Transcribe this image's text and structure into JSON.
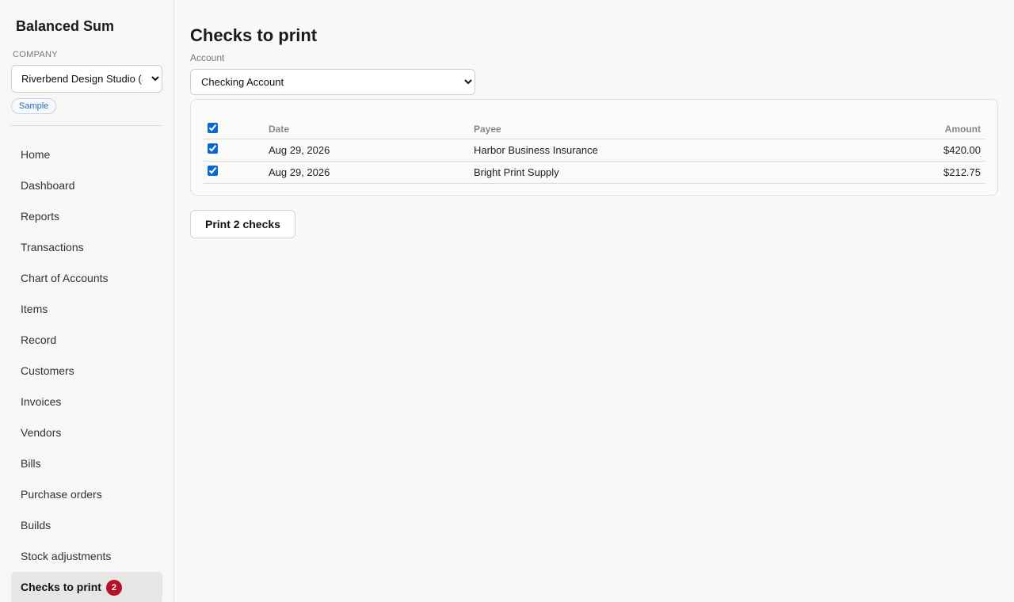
{
  "app": {
    "title": "Balanced Sum"
  },
  "company": {
    "label": "COMPANY",
    "selected": "Riverbend Design Studio (Sample)",
    "badge": "Sample"
  },
  "nav": {
    "items": [
      {
        "label": "Home"
      },
      {
        "label": "Dashboard"
      },
      {
        "label": "Reports"
      },
      {
        "label": "Transactions"
      },
      {
        "label": "Chart of Accounts"
      },
      {
        "label": "Items"
      },
      {
        "label": "Record"
      },
      {
        "label": "Customers"
      },
      {
        "label": "Invoices"
      },
      {
        "label": "Vendors"
      },
      {
        "label": "Bills"
      },
      {
        "label": "Purchase orders"
      },
      {
        "label": "Builds"
      },
      {
        "label": "Stock adjustments"
      },
      {
        "label": "Checks to print",
        "badge": "2",
        "active": true
      }
    ]
  },
  "page": {
    "title": "Checks to print",
    "account_label": "Account",
    "account_selected": "Checking Account"
  },
  "table": {
    "select_all_checked": true,
    "columns": {
      "date": "Date",
      "payee": "Payee",
      "amount": "Amount"
    },
    "rows": [
      {
        "checked": true,
        "date": "Aug 29, 2026",
        "payee": "Harbor Business Insurance",
        "amount": "$420.00"
      },
      {
        "checked": true,
        "date": "Aug 29, 2026",
        "payee": "Bright Print Supply",
        "amount": "$212.75"
      }
    ]
  },
  "actions": {
    "print_label": "Print 2 checks"
  },
  "colors": {
    "badge_red": "#b3102a",
    "checkbox_blue": "#0b66d6",
    "sample_blue": "#2c6db1"
  }
}
